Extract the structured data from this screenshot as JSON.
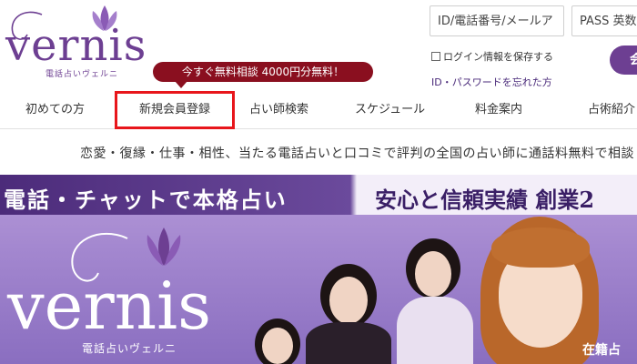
{
  "brand": {
    "logo_word": "vernis",
    "logo_sub": "電話占いヴェルニ"
  },
  "login": {
    "id_placeholder": "ID/電話番号/メールアド",
    "pass_placeholder": "PASS 英数字",
    "remember_label": "ログイン情報を保存する",
    "forgot_label": "ID・パスワードを忘れた方",
    "submit_label": "会員"
  },
  "promo": {
    "text": "今すぐ無料相談 4000円分無料！"
  },
  "nav": {
    "items": [
      {
        "label": "初めての方"
      },
      {
        "label": "新規会員登録"
      },
      {
        "label": "占い師検索"
      },
      {
        "label": "スケジュール"
      },
      {
        "label": "料金案内"
      },
      {
        "label": "占術紹介"
      }
    ]
  },
  "tagline": "恋愛・復縁・仕事・相性、当たる電話占いと口コミで評判の全国の占い師に通話料無料で相談",
  "banner": {
    "left_text": "電話・チャットで本格占い",
    "right_text": "安心と信頼実績 創業2",
    "logo_word": "vernis",
    "logo_sub": "電話占いヴェルニ",
    "badge": "在籍占"
  },
  "colors": {
    "brand": "#6d3f92",
    "promo": "#8a0f1f",
    "highlight": "#e8161b"
  }
}
